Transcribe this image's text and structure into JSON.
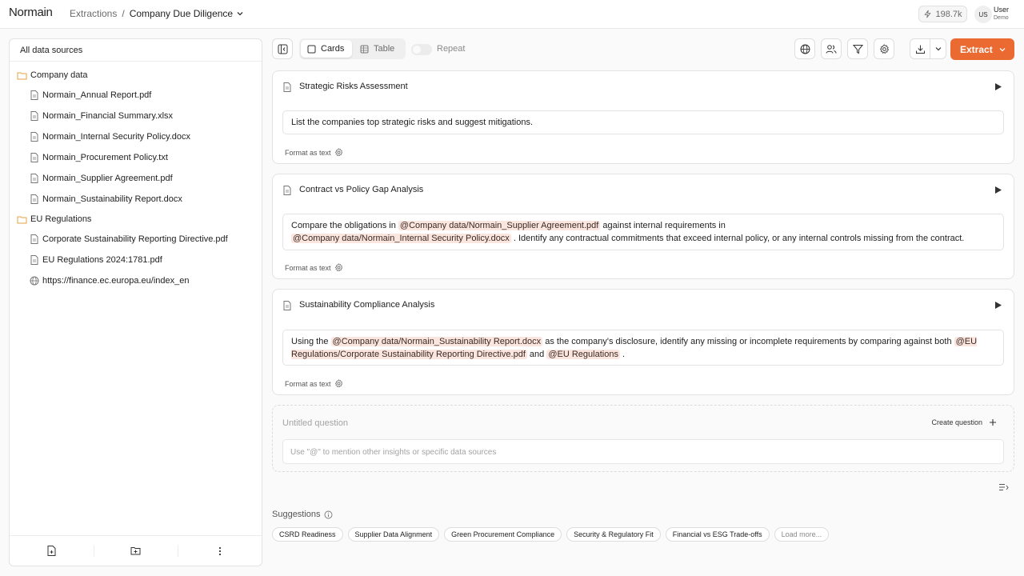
{
  "header": {
    "logo": "Normain",
    "breadcrumb_parent": "Extractions",
    "breadcrumb_sep": "/",
    "breadcrumb_current": "Company Due Diligence",
    "credits": "198.7k",
    "user_initials": "US",
    "user_name": "User",
    "user_role": "Demo"
  },
  "sidebar": {
    "header": "All data sources",
    "folders": [
      {
        "name": "Company data",
        "files": [
          {
            "name": "Normain_Annual Report.pdf",
            "icon": "file-icon"
          },
          {
            "name": "Normain_Financial Summary.xlsx",
            "icon": "file-icon"
          },
          {
            "name": "Normain_Internal Security Policy.docx",
            "icon": "file-icon"
          },
          {
            "name": "Normain_Procurement Policy.txt",
            "icon": "file-icon"
          },
          {
            "name": "Normain_Supplier Agreement.pdf",
            "icon": "file-icon"
          },
          {
            "name": "Normain_Sustainability Report.docx",
            "icon": "file-icon"
          }
        ]
      },
      {
        "name": "EU Regulations",
        "files": [
          {
            "name": "Corporate Sustainability Reporting Directive.pdf",
            "icon": "file-icon"
          },
          {
            "name": "EU Regulations 2024:1781.pdf",
            "icon": "file-icon"
          },
          {
            "name": "https://finance.ec.europa.eu/index_en",
            "icon": "globe-icon"
          }
        ]
      }
    ]
  },
  "toolbar": {
    "view_cards": "Cards",
    "view_table": "Table",
    "repeat_label": "Repeat",
    "repeat_on": false,
    "extract_label": "Extract",
    "accent": "#ea6a31"
  },
  "cards": [
    {
      "title": "Strategic Risks Assessment",
      "prompt": {
        "t1": "List the companies top strategic risks and suggest mitigations."
      },
      "format": "Format as text"
    },
    {
      "title": "Contract vs Policy Gap Analysis",
      "prompt": {
        "t1": "Compare the obligations in ",
        "m1": "@Company data/Normain_Supplier Agreement.pdf",
        "t2": " against internal requirements in ",
        "m2": "@Company data/Normain_Internal Security Policy.docx",
        "t3": " . Identify any contractual commitments that exceed internal policy, or any internal controls missing from the contract."
      },
      "format": "Format as text"
    },
    {
      "title": "Sustainability Compliance Analysis",
      "prompt": {
        "t1": "Using the ",
        "m1": "@Company data/Normain_Sustainability Report.docx",
        "t2": " as the company's disclosure, identify any missing or incomplete requirements by comparing against both ",
        "m2": "@EU Regulations/Corporate Sustainability Reporting Directive.pdf",
        "t3": " and ",
        "m3": "@EU Regulations",
        "t4": " ."
      },
      "format": "Format as text"
    }
  ],
  "new_question": {
    "title_placeholder": "Untitled question",
    "create_label": "Create question",
    "input_placeholder": "Use \"@\" to mention other insights or specific data sources"
  },
  "suggestions": {
    "title": "Suggestions",
    "chips": [
      "CSRD Readiness",
      "Supplier Data Alignment",
      "Green Procurement Compliance",
      "Security & Regulatory Fit",
      "Financial vs ESG Trade-offs"
    ],
    "more": "Load more..."
  }
}
